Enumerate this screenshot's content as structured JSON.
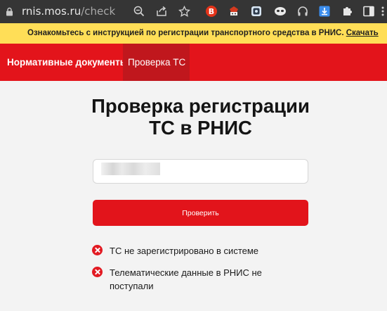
{
  "browser": {
    "url_host": "rnis.mos.ru",
    "url_path": "/check",
    "icons": [
      "lock-icon",
      "zoom-icon",
      "share-icon",
      "star-icon",
      "extension-b-icon",
      "extension-monkey-icon",
      "extension-square-icon",
      "extension-mask-icon",
      "headphones-icon",
      "download-icon",
      "puzzle-icon",
      "sidebar-icon",
      "menu-icon"
    ],
    "colors": {
      "toolbar": "#353535",
      "ext_b": "#e3341a",
      "download": "#3b8ded"
    }
  },
  "infobar": {
    "message": "Ознакомьтесь с инструкцией по регистрации транспортного средства в РНИС.",
    "link": "Скачать",
    "bg": "#ffde57"
  },
  "nav": {
    "items": [
      {
        "label": "Нормативные документы"
      },
      {
        "label": "Проверка ТС"
      }
    ],
    "bg": "#e3141b"
  },
  "main": {
    "title_line1": "Проверка регистрации",
    "title_line2": "ТС в РНИС",
    "plate_value": "",
    "button_label": "Проверить",
    "results": [
      {
        "icon": "error-icon",
        "text": "ТС не зарегистрировано в системе"
      },
      {
        "icon": "error-icon",
        "text": "Телематические данные в РНИС не поступали"
      }
    ]
  }
}
